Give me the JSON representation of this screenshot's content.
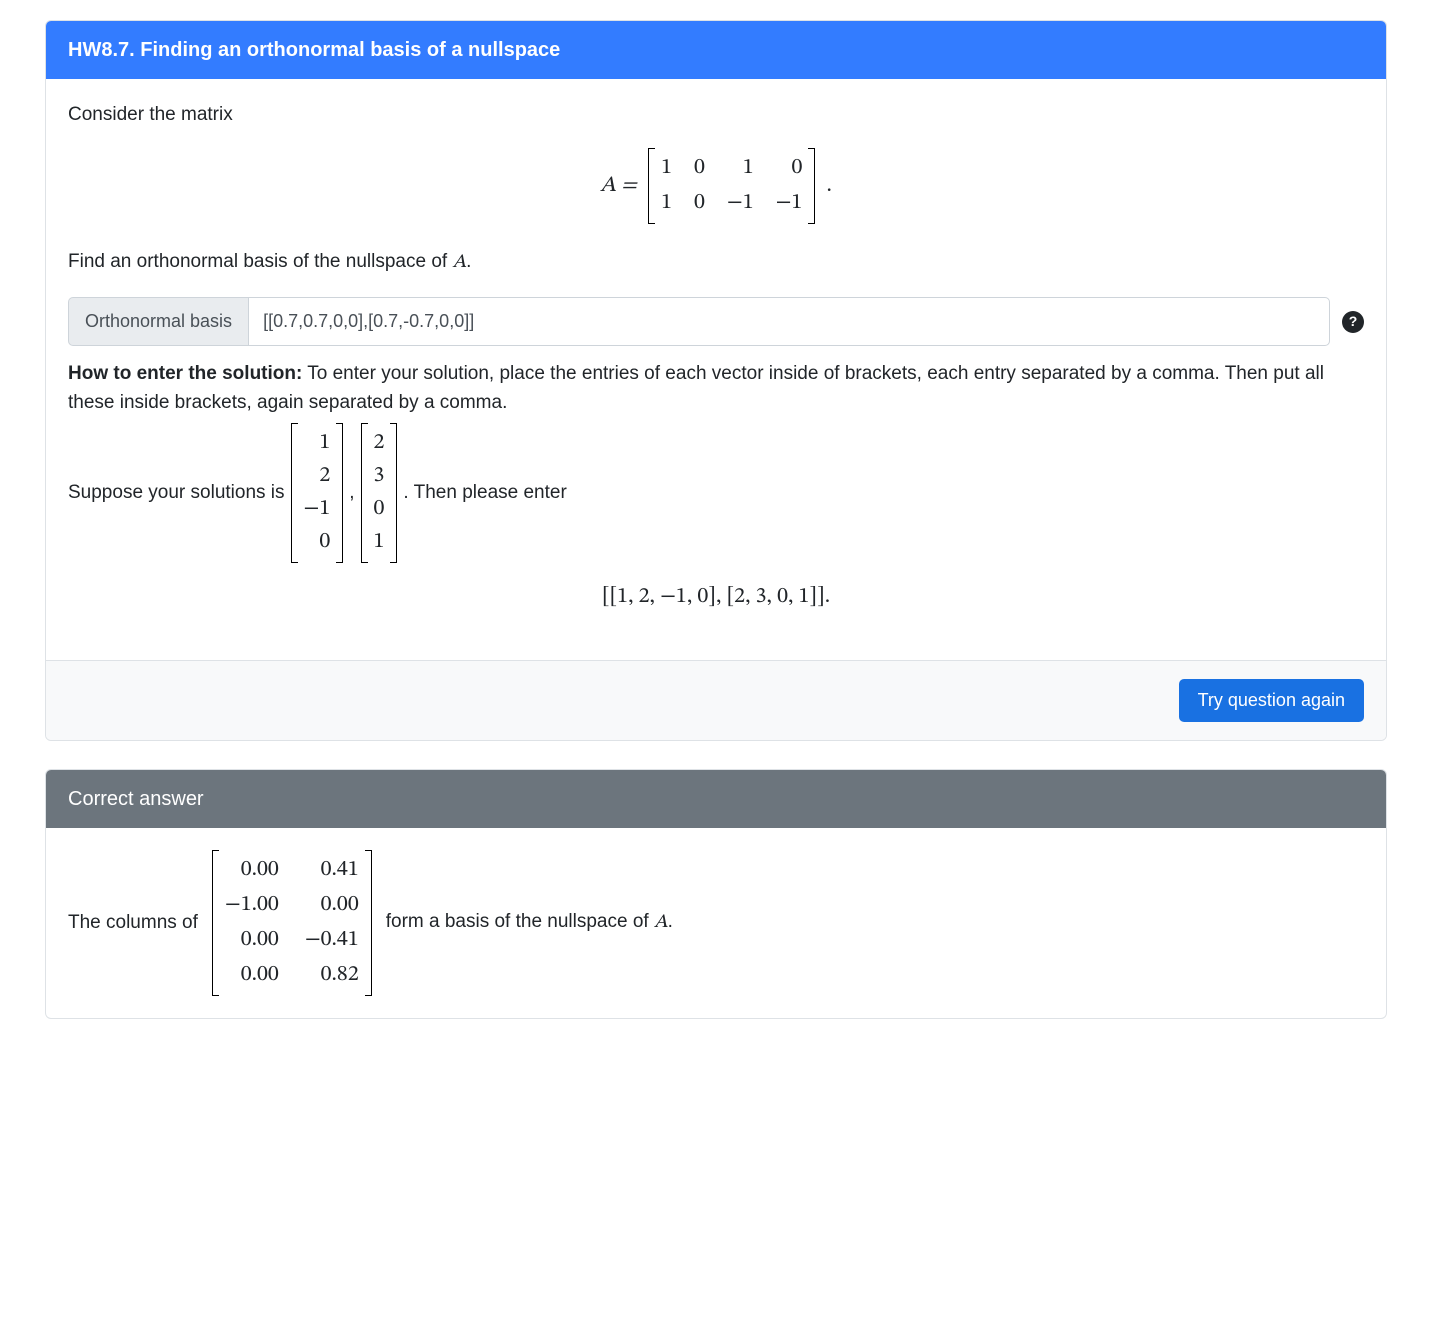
{
  "question": {
    "header": "HW8.7. Finding an orthonormal basis of a nullspace",
    "intro": "Consider the matrix",
    "matrix_lhs": "A =",
    "matrix_A": [
      [
        "1",
        "0",
        "1",
        "0"
      ],
      [
        "1",
        "0",
        "−1",
        "−1"
      ]
    ],
    "matrix_trailer": ".",
    "prompt_before": "Find an orthonormal basis of the nullspace of ",
    "prompt_var": "A",
    "prompt_after": ".",
    "input_label": "Orthonormal basis",
    "input_value": "[[0.7,0.7,0,0],[0.7,-0.7,0,0]]",
    "howto_bold": "How to enter the solution:",
    "howto_rest": " To enter your solution, place the entries of each vector inside of brackets, each entry separated by a comma. Then put all these inside brackets, again separated by a comma.",
    "suppose_before": "Suppose your solutions is",
    "example_vec1": [
      "1",
      "2",
      "−1",
      "0"
    ],
    "example_vec2": [
      "2",
      "3",
      "0",
      "1"
    ],
    "suppose_after": ". Then please enter",
    "example_entry": "[[1, 2, −1, 0], [2, 3, 0, 1]].",
    "retry_button": "Try question again"
  },
  "answer": {
    "header": "Correct answer",
    "text_before": "The columns of",
    "matrix": [
      [
        "0.00",
        "0.41"
      ],
      [
        "−1.00",
        "0.00"
      ],
      [
        "0.00",
        "−0.41"
      ],
      [
        "0.00",
        "0.82"
      ]
    ],
    "text_after_1": "form a basis of the nullspace of ",
    "text_after_var": "A",
    "text_after_2": "."
  },
  "help_icon_glyph": "?"
}
